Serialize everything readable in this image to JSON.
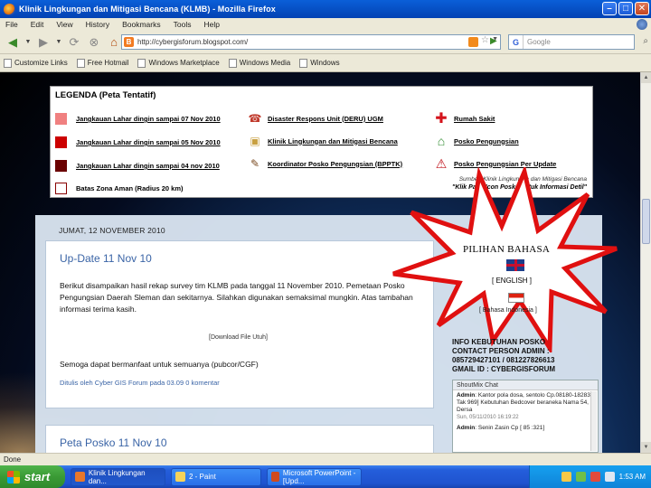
{
  "window": {
    "title": "Klinik Lingkungan dan Mitigasi Bencana (KLMB) - Mozilla Firefox"
  },
  "menu": [
    "File",
    "Edit",
    "View",
    "History",
    "Bookmarks",
    "Tools",
    "Help"
  ],
  "nav": {
    "url": "http://cybergisforum.blogspot.com/",
    "search_placeholder": "Google"
  },
  "bookmarks": [
    "Customize Links",
    "Free Hotmail",
    "Windows Marketplace",
    "Windows Media",
    "Windows"
  ],
  "legend": {
    "title": "LEGENDA (Peta Tentatif)",
    "left_items": [
      {
        "label": "Jangkauan Lahar dingin sampai 07 Nov 2010",
        "color": "#f08080"
      },
      {
        "label": "Jangkauan Lahar dingin sampai 05 Nov 2010",
        "color": "#cc0000"
      },
      {
        "label": "Jangkauan Lahar dingin sampai 04 nov 2010",
        "color": "#6a0000"
      },
      {
        "label": "Batas Zona Aman (Radius 20 km)",
        "color": "#ffffff"
      }
    ],
    "mid_items": [
      {
        "label": "Disaster Respons Unit (DERU) UGM",
        "icon": "phone-icon"
      },
      {
        "label": "Klinik Lingkungan dan Mitigasi Bencana",
        "icon": "clipboard-icon"
      },
      {
        "label": "Koordinator Posko Pengungsian (BPPTK)",
        "icon": "coordinator-icon"
      }
    ],
    "right_items": [
      {
        "label": "Rumah Sakit",
        "icon": "hospital-cross-icon"
      },
      {
        "label": "Posko Pengungsian",
        "icon": "shelter-house-icon"
      },
      {
        "label": "Posko Pengungsian Per Update",
        "icon": "warning-icon"
      }
    ],
    "source": "Sumber: Klinik Lingkungan dan Mitigasi Bencana",
    "click_note": "\"Klik Pada Icon Posko untuk Informasi Detil\""
  },
  "blog": {
    "date_header": "JUMAT, 12 NOVEMBER 2010",
    "post1": {
      "title": "Up-Date 11 Nov 10",
      "body": "Berikut disampaikan hasil rekap survey tim KLMB pada tanggal 11 November 2010. Pemetaan Posko Pengungsian Daerah Sleman dan sekitarnya. Silahkan digunakan semaksimal mungkin. Atas tambahan informasi terima kasih.",
      "download": "[Download File Utuh]",
      "hope": "Semoga dapat bermanfaat untuk semuanya (pubcor/CGF)",
      "footer": "Ditulis oleh Cyber GIS Forum pada 03.09     0 komentar"
    },
    "post2": {
      "title": "Peta Posko 11 Nov 10"
    }
  },
  "sidebar": {
    "language_title": "PILIHAN BAHASA",
    "english": "[ ENGLISH ]",
    "indonesian": "[ Bahasa Indonesia ]",
    "info": "INFO KEBUTUHAN POSKO\nCONTACT PERSON ADMIN :\n085729427101 / 081227826613\nGMAIL ID : CYBERGISFORUM",
    "shoutbox_title": "ShoutMix Chat",
    "shouts": [
      {
        "name": "Admin",
        "text": "Kantor pola dosa, sentolo Cp.08180-182831 Tak 969] Kebutuhan Bedcover beraneka Nama 54, Dersa",
        "time": "Sun, 05/11/2010 16:19:22"
      },
      {
        "name": "Admin",
        "text": "Senin Zasin Cp [ 85 :321]",
        "time": ""
      }
    ]
  },
  "status": "Done",
  "taskbar": {
    "start": "start",
    "tasks": [
      "Klinik Lingkungan dan...",
      "2 - Paint",
      "Microsoft PowerPoint - [Upd..."
    ],
    "clock": "1:53 AM"
  }
}
